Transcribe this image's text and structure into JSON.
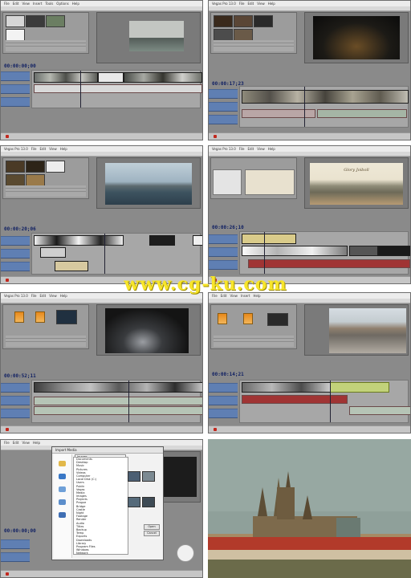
{
  "watermark": "www.cg-ku.com",
  "menu_items": [
    "File",
    "Edit",
    "View",
    "Insert",
    "Tools",
    "Options",
    "Help"
  ],
  "screens": [
    {
      "title": "",
      "timecode": "00:00:00;00"
    },
    {
      "title": "Vegas Pro 13.0",
      "timecode": "00:00:17;23"
    },
    {
      "title": "Vegas Pro 13.0",
      "timecode": "00:00:20;06"
    },
    {
      "title": "Vegas Pro 13.0",
      "timecode": "00:00:26;10"
    },
    {
      "title": "Vegas Pro 13.0",
      "timecode": "00:00:52;11"
    },
    {
      "title": "",
      "timecode": "00:00:14;21"
    },
    {
      "title": "",
      "timecode": "00:00:00;00"
    }
  ],
  "preview_title_text": "Glory Joiboll",
  "dialog": {
    "title": "Import Media",
    "look_in": "Images",
    "folder_items": [
      "Documents",
      "Desktop",
      "Music",
      "Pictures",
      "Videos",
      "Computer",
      "Local Disk (C:)",
      "Users",
      "Public",
      "Vegas",
      "Media",
      "Images",
      "Projects",
      "Prague",
      "Bridge",
      "Castle",
      "Night",
      "Footage",
      "Render",
      "Audio",
      "Titles",
      "Backup",
      "Temp",
      "Exports",
      "Downloads",
      "Library",
      "Program Files",
      "Windows",
      "Network",
      "Recycle"
    ],
    "open_label": "Open",
    "cancel_label": "Cancel"
  },
  "colors": {
    "app_gray": "#8a8a8a",
    "track_blue": "#5f7fb3",
    "timecode_blue": "#0f1f62",
    "watermark_yellow": "#f7e52a",
    "audio_red": "#a03434"
  }
}
